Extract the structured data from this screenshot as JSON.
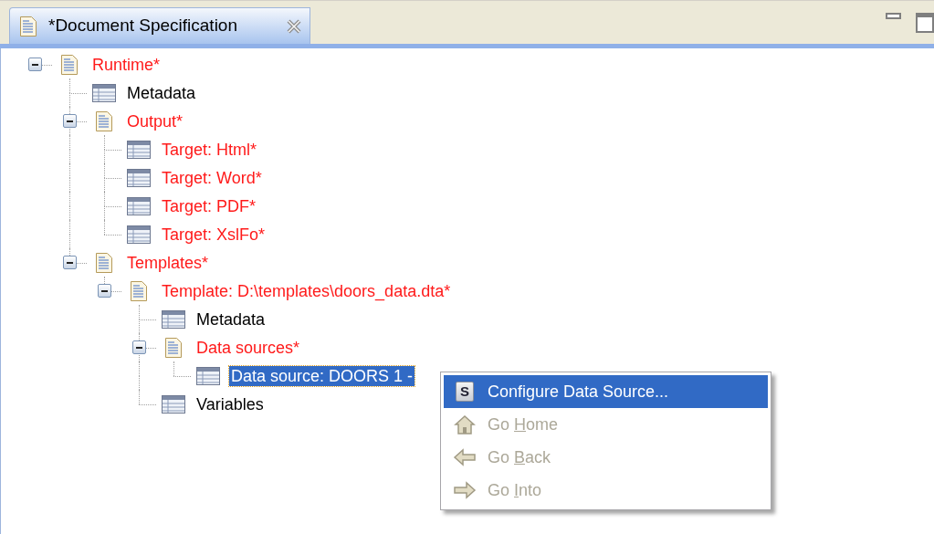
{
  "tabs": [
    {
      "label": "*Document Specification",
      "selected": true
    }
  ],
  "tree": [
    {
      "label": "Runtime*",
      "kind": "document",
      "modified": true,
      "expanded": true,
      "selected": false,
      "children": [
        {
          "label": "Metadata",
          "kind": "table",
          "modified": false,
          "selected": false
        },
        {
          "label": "Output*",
          "kind": "document",
          "modified": true,
          "expanded": true,
          "selected": false,
          "children": [
            {
              "label": "Target: Html*",
              "kind": "table",
              "modified": true,
              "selected": false
            },
            {
              "label": "Target: Word*",
              "kind": "table",
              "modified": true,
              "selected": false
            },
            {
              "label": "Target: PDF*",
              "kind": "table",
              "modified": true,
              "selected": false
            },
            {
              "label": "Target: XslFo*",
              "kind": "table",
              "modified": true,
              "selected": false
            }
          ]
        },
        {
          "label": "Templates*",
          "kind": "document",
          "modified": true,
          "expanded": true,
          "selected": false,
          "children": [
            {
              "label": "Template: D:\\templates\\doors_data.dta*",
              "kind": "document",
              "modified": true,
              "expanded": true,
              "selected": false,
              "children": [
                {
                  "label": "Metadata",
                  "kind": "table",
                  "modified": false,
                  "selected": false
                },
                {
                  "label": "Data sources*",
                  "kind": "document",
                  "modified": true,
                  "expanded": true,
                  "selected": false,
                  "children": [
                    {
                      "label": "Data source: DOORS 1 -",
                      "kind": "table",
                      "selected": true
                    }
                  ]
                },
                {
                  "label": "Variables",
                  "kind": "table",
                  "modified": false,
                  "selected": false
                }
              ]
            }
          ]
        }
      ]
    }
  ],
  "context_menu": [
    {
      "kind": "configure",
      "badge": "S",
      "label_parts": [
        "Configure Data Source..."
      ],
      "selected": true,
      "disabled": false
    },
    {
      "kind": "home",
      "label_parts": [
        "Go ",
        "H",
        "ome"
      ],
      "selected": false,
      "disabled": true
    },
    {
      "kind": "back",
      "label_parts": [
        "Go ",
        "B",
        "ack"
      ],
      "selected": false,
      "disabled": true
    },
    {
      "kind": "into",
      "label_parts": [
        "Go ",
        "I",
        "nto"
      ],
      "selected": false,
      "disabled": true
    }
  ]
}
